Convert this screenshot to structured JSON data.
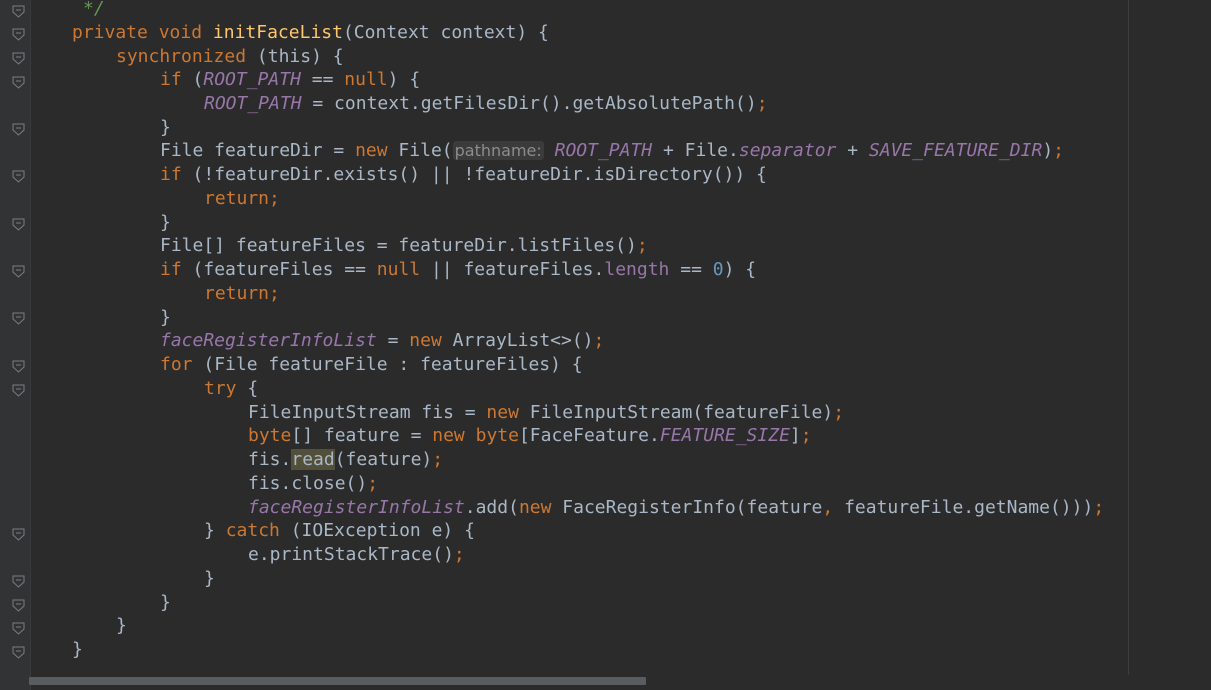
{
  "code": {
    "comment_end": "*/",
    "kw_private": "private",
    "kw_void": "void",
    "method_name": "initFaceList",
    "params": "(Context context) {",
    "kw_synchronized": "synchronized",
    "sync_args": "(this) {",
    "kw_if": "if",
    "root_path": "ROOT_PATH",
    "eq_op": " == ",
    "kw_null": "null",
    "paren_brace": ") {",
    "root_assign": " = context.getFilesDir().getAbsolutePath()",
    "semicolon": ";",
    "close_brace": "}",
    "featuredir_decl": "File featureDir = ",
    "kw_new": "new",
    "file_ctor": " File(",
    "param_hint": "pathname:",
    "plus_file": " + File.",
    "separator": "separator",
    "plus": " + ",
    "save_feature_dir": "SAVE_FEATURE_DIR",
    "close_paren": ")",
    "exists_check": " (!featureDir.exists() || !featureDir.isDirectory()) {",
    "kw_return": "return",
    "list_files_decl": "File[] featureFiles = featureDir.listFiles()",
    "feature_files_check": " (featureFiles == ",
    "or_feature_files": " || featureFiles.",
    "length": "length",
    "zero": "0",
    "face_list": "faceRegisterInfoList",
    "assign": " = ",
    "arraylist": " ArrayList<>()",
    "kw_for": "for",
    "for_args": " (File featureFile : featureFiles) {",
    "kw_try": "try",
    "open_brace": " {",
    "fis_decl": "FileInputStream fis = ",
    "fis_ctor": " FileInputStream(featureFile)",
    "kw_byte": "byte",
    "byte_decl": "[] feature = ",
    "byte_arr": "[FaceFeature.",
    "feature_size": "FEATURE_SIZE",
    "close_bracket": "]",
    "fis_dot": "fis.",
    "read": "read",
    "read_args": "(feature)",
    "fis_close": "fis.close()",
    "add_call": ".add(",
    "face_info_ctor": " FaceRegisterInfo(feature",
    "comma": ",",
    "get_name": " featureFile.getName()))",
    "catch_open": "} ",
    "kw_catch": "catch",
    "catch_args": " (IOException e) {",
    "print_stack": "e.printStackTrace()"
  },
  "icons": {
    "fold_marker": "fold-marker-icon"
  }
}
